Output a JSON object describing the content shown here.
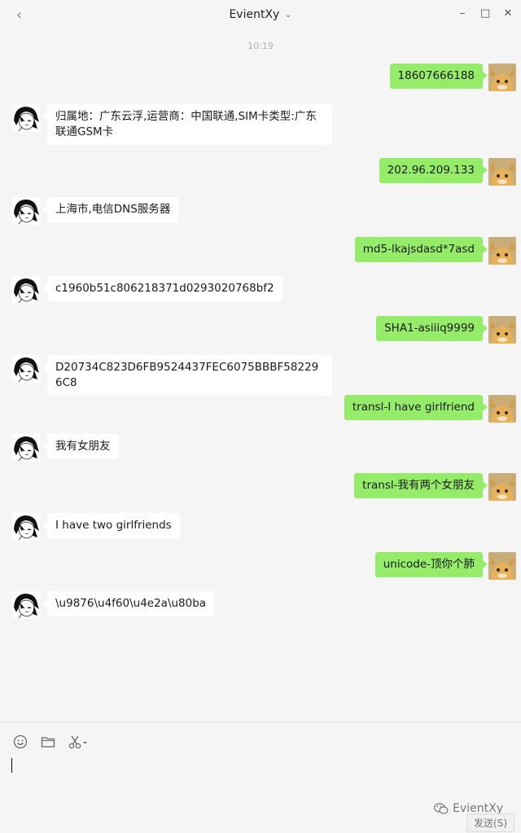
{
  "window": {
    "title": "EvientXy"
  },
  "timestamp": "10:19",
  "messages": [
    {
      "side": "self",
      "text": "18607666188"
    },
    {
      "side": "other",
      "text": "归属地：广东云浮,运营商：中国联通,SIM卡类型:广东联通GSM卡"
    },
    {
      "side": "self",
      "text": "202.96.209.133"
    },
    {
      "side": "other",
      "text": "上海市,电信DNS服务器"
    },
    {
      "side": "self",
      "text": "md5-lkajsdasd*7asd"
    },
    {
      "side": "other",
      "text": "c1960b51c806218371d0293020768bf2"
    },
    {
      "side": "self",
      "text": "SHA1-asiiiq9999"
    },
    {
      "side": "other",
      "text": "D20734C823D6FB9524437FEC6075BBBF582296C8"
    },
    {
      "side": "self",
      "text": "transl-I have girlfriend"
    },
    {
      "side": "other",
      "text": "我有女朋友"
    },
    {
      "side": "self",
      "text": "transl-我有两个女朋友"
    },
    {
      "side": "other",
      "text": "I have two girlfriends"
    },
    {
      "side": "self",
      "text": "unicode-顶你个肺"
    },
    {
      "side": "other",
      "text": "\\u9876\\u4f60\\u4e2a\\u80ba"
    }
  ],
  "composer": {
    "tools": [
      "emoji-icon",
      "folder-icon",
      "scissors-icon"
    ],
    "send_label": "发送(S)",
    "watermark": "EvientXy"
  },
  "colors": {
    "self_bubble": "#95ec69",
    "other_bubble": "#ffffff",
    "background": "#f5f5f5"
  }
}
